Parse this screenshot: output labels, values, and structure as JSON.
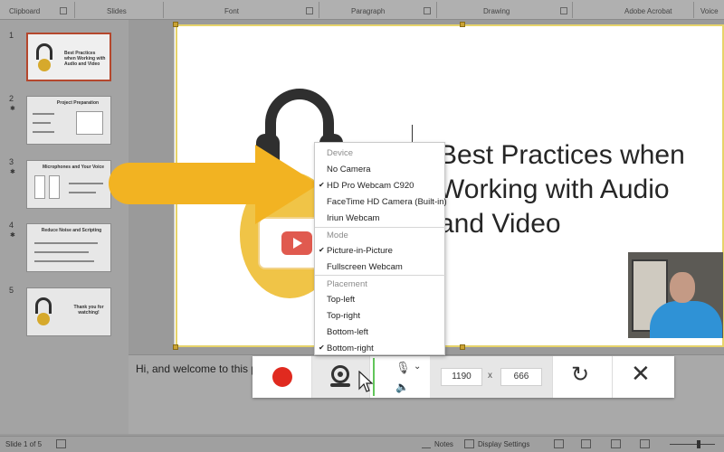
{
  "ribbon": {
    "groups": [
      "Clipboard",
      "Slides",
      "Font",
      "Paragraph",
      "Drawing",
      "Adobe Acrobat",
      "Voice"
    ]
  },
  "thumbnails": [
    {
      "number": "1",
      "title": "Best Practices when Working with Audio and Video",
      "active": true
    },
    {
      "number": "2",
      "title": "Project Preparation",
      "active": false
    },
    {
      "number": "3",
      "title": "Microphones and Your Voice",
      "active": false
    },
    {
      "number": "4",
      "title": "Reduce Noise and Scripting",
      "active": false
    },
    {
      "number": "5",
      "title": "Thank you for watching!",
      "active": false
    }
  ],
  "slide": {
    "title": "Best Practices when Working with Audio and Video"
  },
  "menu": {
    "device_header": "Device",
    "devices": [
      {
        "label": "No Camera",
        "checked": false
      },
      {
        "label": "HD Pro Webcam C920",
        "checked": true
      },
      {
        "label": "FaceTime HD Camera (Built-in)",
        "checked": false
      },
      {
        "label": "Iriun Webcam",
        "checked": false
      }
    ],
    "mode_header": "Mode",
    "modes": [
      {
        "label": "Picture-in-Picture",
        "checked": true
      },
      {
        "label": "Fullscreen Webcam",
        "checked": false
      }
    ],
    "placement_header": "Placement",
    "placements": [
      {
        "label": "Top-left",
        "checked": false
      },
      {
        "label": "Top-right",
        "checked": false
      },
      {
        "label": "Bottom-left",
        "checked": false
      },
      {
        "label": "Bottom-right",
        "checked": true
      }
    ],
    "check_glyph": "✔"
  },
  "toolbar": {
    "width": "1190",
    "times": "x",
    "height": "666",
    "mic_glyph": "🎙",
    "chevron": "⌄",
    "speaker_glyph": "🔈",
    "reset_glyph": "↻",
    "close_glyph": "✕",
    "record_color": "#e02a1f"
  },
  "notes": {
    "text": "Hi, and welcome to this p"
  },
  "status": {
    "slide_info": "Slide 1 of 5",
    "notes_label": "Notes",
    "display_settings": "Display Settings"
  },
  "colors": {
    "arrow": "#f2b322",
    "accent": "#b5472d"
  }
}
